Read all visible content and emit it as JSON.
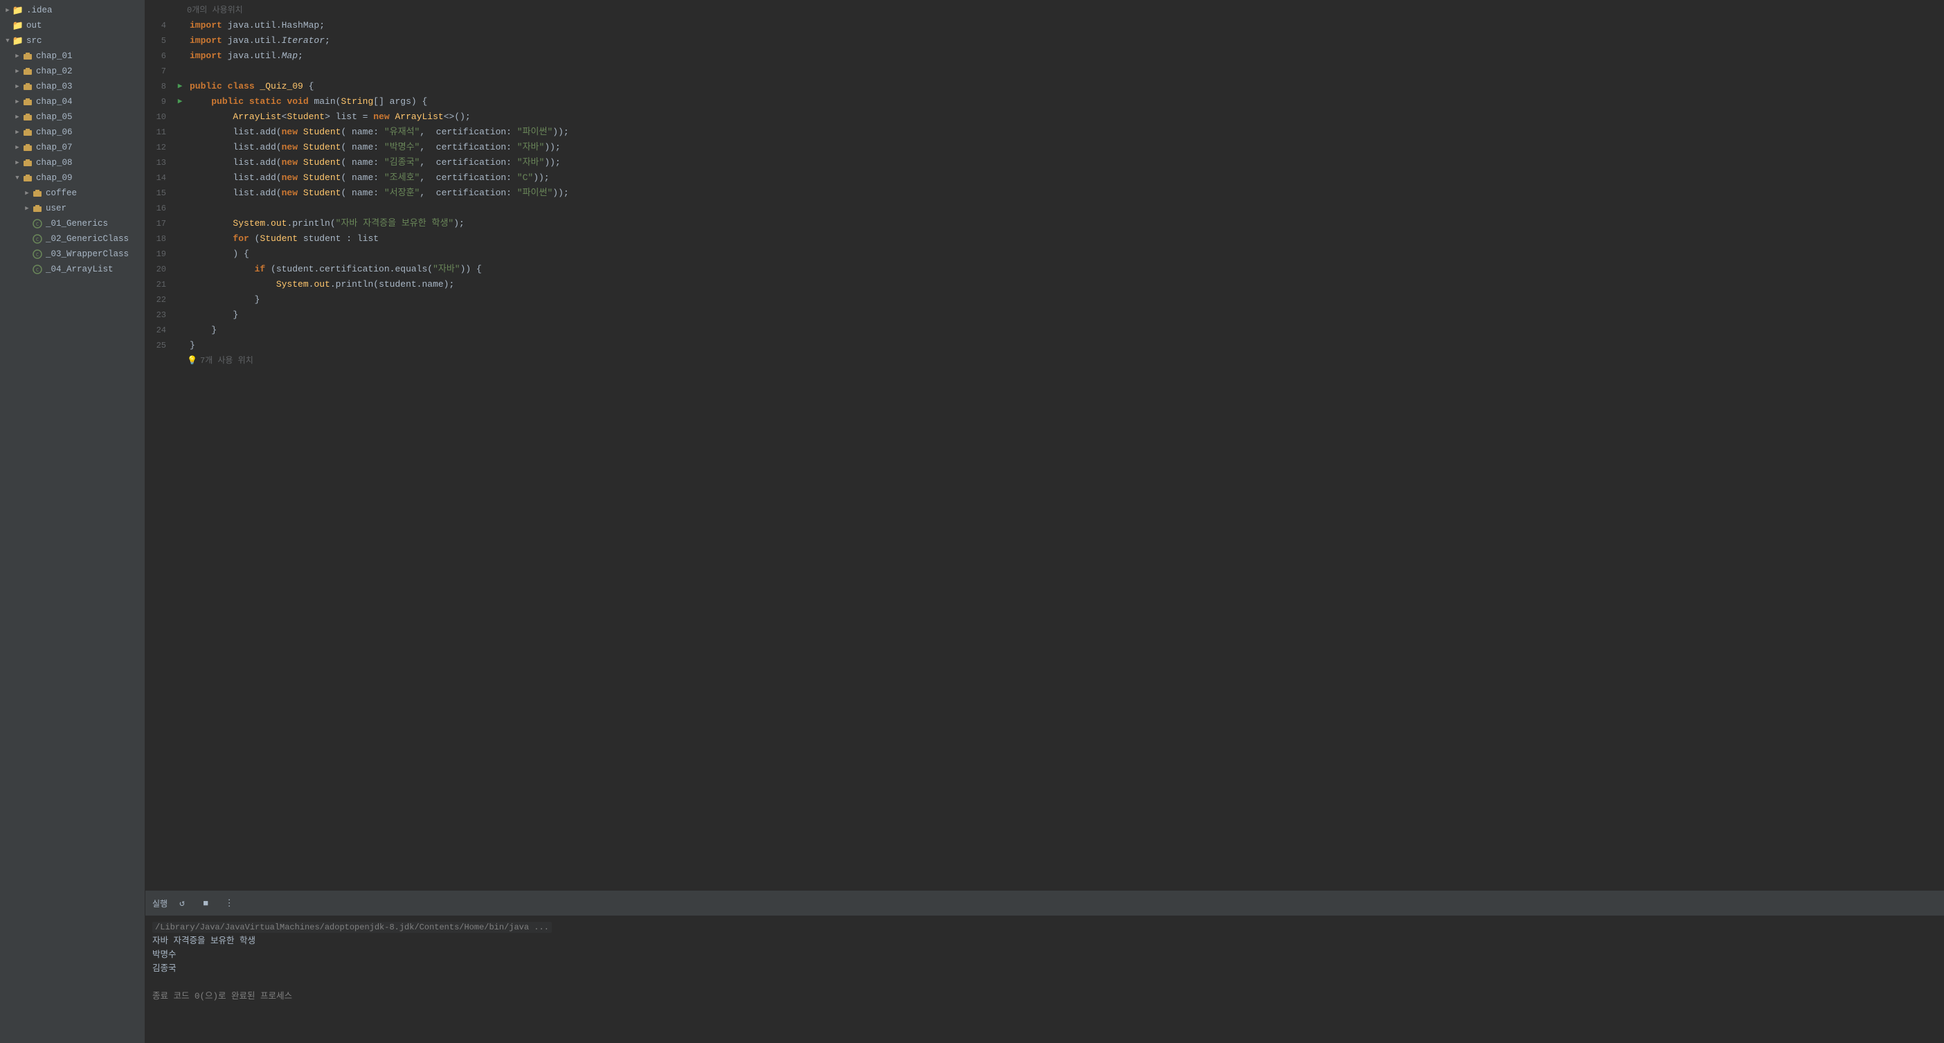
{
  "sidebar": {
    "items": [
      {
        "id": "idea",
        "label": ".idea",
        "indent": "indent-0",
        "type": "folder",
        "arrow": "▶",
        "expanded": false
      },
      {
        "id": "out",
        "label": "out",
        "indent": "indent-0",
        "type": "folder",
        "arrow": "",
        "expanded": false
      },
      {
        "id": "src",
        "label": "src",
        "indent": "indent-0",
        "type": "folder",
        "arrow": "▼",
        "expanded": true
      },
      {
        "id": "chap_01",
        "label": "chap_01",
        "indent": "indent-1",
        "type": "package",
        "arrow": "▶",
        "expanded": false
      },
      {
        "id": "chap_02",
        "label": "chap_02",
        "indent": "indent-1",
        "type": "package",
        "arrow": "▶",
        "expanded": false
      },
      {
        "id": "chap_03",
        "label": "chap_03",
        "indent": "indent-1",
        "type": "package",
        "arrow": "▶",
        "expanded": false
      },
      {
        "id": "chap_04",
        "label": "chap_04",
        "indent": "indent-1",
        "type": "package",
        "arrow": "▶",
        "expanded": false
      },
      {
        "id": "chap_05",
        "label": "chap_05",
        "indent": "indent-1",
        "type": "package",
        "arrow": "▶",
        "expanded": false
      },
      {
        "id": "chap_06",
        "label": "chap_06",
        "indent": "indent-1",
        "type": "package",
        "arrow": "▶",
        "expanded": false
      },
      {
        "id": "chap_07",
        "label": "chap_07",
        "indent": "indent-1",
        "type": "package",
        "arrow": "▶",
        "expanded": false
      },
      {
        "id": "chap_08",
        "label": "chap_08",
        "indent": "indent-1",
        "type": "package",
        "arrow": "▶",
        "expanded": false
      },
      {
        "id": "chap_09",
        "label": "chap_09",
        "indent": "indent-1",
        "type": "package",
        "arrow": "▼",
        "expanded": true
      },
      {
        "id": "coffee",
        "label": "coffee",
        "indent": "indent-2",
        "type": "package",
        "arrow": "▶",
        "expanded": false
      },
      {
        "id": "user",
        "label": "user",
        "indent": "indent-2",
        "type": "package",
        "arrow": "▶",
        "expanded": false
      },
      {
        "id": "_01_Generics",
        "label": "_01_Generics",
        "indent": "indent-2",
        "type": "class",
        "arrow": "",
        "expanded": false
      },
      {
        "id": "_02_GenericClass",
        "label": "_02_GenericClass",
        "indent": "indent-2",
        "type": "class",
        "arrow": "",
        "expanded": false
      },
      {
        "id": "_03_WrapperClass",
        "label": "_03_WrapperClass",
        "indent": "indent-2",
        "type": "class",
        "arrow": "",
        "expanded": false
      },
      {
        "id": "_04_ArrayList",
        "label": "_04_ArrayList",
        "indent": "indent-2",
        "type": "class",
        "arrow": "",
        "expanded": false
      }
    ]
  },
  "code": {
    "hint_top": "0개의 사용위치",
    "hint_bottom": "7개 사용 위치",
    "lines": [
      {
        "num": 4,
        "run": false,
        "content": "import java.util.HashMap;",
        "tokens": [
          {
            "t": "kw",
            "v": "import "
          },
          {
            "t": "plain",
            "v": "java.util.HashMap;"
          }
        ]
      },
      {
        "num": 5,
        "run": false,
        "content": "import java.util.Iterator;",
        "tokens": [
          {
            "t": "kw",
            "v": "import "
          },
          {
            "t": "plain",
            "v": "java.util."
          },
          {
            "t": "italic plain",
            "v": "Iterator"
          },
          {
            "t": "plain",
            "v": ";"
          }
        ]
      },
      {
        "num": 6,
        "run": false,
        "content": "import java.util.Map;",
        "tokens": [
          {
            "t": "kw",
            "v": "import "
          },
          {
            "t": "plain",
            "v": "java.util."
          },
          {
            "t": "italic plain",
            "v": "Map"
          },
          {
            "t": "plain",
            "v": ";"
          }
        ]
      },
      {
        "num": 7,
        "run": false,
        "content": "",
        "tokens": []
      },
      {
        "num": 8,
        "run": true,
        "content": "public class _Quiz_09 {",
        "tokens": [
          {
            "t": "kw",
            "v": "public "
          },
          {
            "t": "kw",
            "v": "class "
          },
          {
            "t": "cls",
            "v": "_Quiz_09"
          },
          {
            "t": "plain",
            "v": " {"
          }
        ]
      },
      {
        "num": 9,
        "run": true,
        "content": "    public static void main(String[] args) {",
        "tokens": [
          {
            "t": "plain",
            "v": "    "
          },
          {
            "t": "kw",
            "v": "public "
          },
          {
            "t": "kw",
            "v": "static "
          },
          {
            "t": "kw",
            "v": "void "
          },
          {
            "t": "plain",
            "v": "main("
          },
          {
            "t": "cls",
            "v": "String"
          },
          {
            "t": "plain",
            "v": "[] args) {"
          }
        ]
      },
      {
        "num": 10,
        "run": false,
        "content": "        ArrayList<Student> list = new ArrayList<>();",
        "tokens": [
          {
            "t": "plain",
            "v": "        "
          },
          {
            "t": "cls",
            "v": "ArrayList"
          },
          {
            "t": "plain",
            "v": "<"
          },
          {
            "t": "cls",
            "v": "Student"
          },
          {
            "t": "plain",
            "v": "> list = "
          },
          {
            "t": "kw",
            "v": "new "
          },
          {
            "t": "cls",
            "v": "ArrayList"
          },
          {
            "t": "plain",
            "v": "<>();"
          }
        ]
      },
      {
        "num": 11,
        "run": false,
        "content": "        list.add(new Student( name: \"유재석\",  certification: \"파이썬\"));",
        "tokens": [
          {
            "t": "plain",
            "v": "        list.add("
          },
          {
            "t": "kw",
            "v": "new "
          },
          {
            "t": "cls",
            "v": "Student"
          },
          {
            "t": "plain",
            "v": "( name: "
          },
          {
            "t": "str",
            "v": "\"유재석\""
          },
          {
            "t": "plain",
            "v": ",  certification: "
          },
          {
            "t": "str",
            "v": "\"파이썬\""
          },
          {
            "t": "plain",
            "v": "));"
          }
        ]
      },
      {
        "num": 12,
        "run": false,
        "content": "        list.add(new Student( name: \"박명수\",  certification: \"자바\"));",
        "tokens": [
          {
            "t": "plain",
            "v": "        list.add("
          },
          {
            "t": "kw",
            "v": "new "
          },
          {
            "t": "cls",
            "v": "Student"
          },
          {
            "t": "plain",
            "v": "( name: "
          },
          {
            "t": "str",
            "v": "\"박명수\""
          },
          {
            "t": "plain",
            "v": ",  certification: "
          },
          {
            "t": "str",
            "v": "\"자바\""
          },
          {
            "t": "plain",
            "v": "));"
          }
        ]
      },
      {
        "num": 13,
        "run": false,
        "content": "        list.add(new Student( name: \"김종국\",  certification: \"자바\"));",
        "tokens": [
          {
            "t": "plain",
            "v": "        list.add("
          },
          {
            "t": "kw",
            "v": "new "
          },
          {
            "t": "cls",
            "v": "Student"
          },
          {
            "t": "plain",
            "v": "( name: "
          },
          {
            "t": "str",
            "v": "\"김종국\""
          },
          {
            "t": "plain",
            "v": ",  certification: "
          },
          {
            "t": "str",
            "v": "\"자바\""
          },
          {
            "t": "plain",
            "v": "));"
          }
        ]
      },
      {
        "num": 14,
        "run": false,
        "content": "        list.add(new Student( name: \"조세호\",  certification: \"C\"));",
        "tokens": [
          {
            "t": "plain",
            "v": "        list.add("
          },
          {
            "t": "kw",
            "v": "new "
          },
          {
            "t": "cls",
            "v": "Student"
          },
          {
            "t": "plain",
            "v": "( name: "
          },
          {
            "t": "str",
            "v": "\"조세호\""
          },
          {
            "t": "plain",
            "v": ",  certification: "
          },
          {
            "t": "str",
            "v": "\"C\""
          },
          {
            "t": "plain",
            "v": "));"
          }
        ]
      },
      {
        "num": 15,
        "run": false,
        "content": "        list.add(new Student( name: \"서장훈\",  certification: \"파이썬\"));",
        "tokens": [
          {
            "t": "plain",
            "v": "        list.add("
          },
          {
            "t": "kw",
            "v": "new "
          },
          {
            "t": "cls",
            "v": "Student"
          },
          {
            "t": "plain",
            "v": "( name: "
          },
          {
            "t": "str",
            "v": "\"서장훈\""
          },
          {
            "t": "plain",
            "v": ",  certification: "
          },
          {
            "t": "str",
            "v": "\"파이썬\""
          },
          {
            "t": "plain",
            "v": "));"
          }
        ]
      },
      {
        "num": 16,
        "run": false,
        "content": "",
        "tokens": []
      },
      {
        "num": 17,
        "run": false,
        "content": "        System.out.println(\"자바 자격증을 보유한 학생\");",
        "tokens": [
          {
            "t": "plain",
            "v": "        "
          },
          {
            "t": "cls",
            "v": "System"
          },
          {
            "t": "plain",
            "v": "."
          },
          {
            "t": "fn",
            "v": "out"
          },
          {
            "t": "plain",
            "v": ".println("
          },
          {
            "t": "str",
            "v": "\"자바 자격증을 보유한 학생\""
          },
          {
            "t": "plain",
            "v": ");"
          }
        ]
      },
      {
        "num": 18,
        "run": false,
        "content": "        for (Student student : list",
        "tokens": [
          {
            "t": "plain",
            "v": "        "
          },
          {
            "t": "kw",
            "v": "for "
          },
          {
            "t": "plain",
            "v": "("
          },
          {
            "t": "cls",
            "v": "Student"
          },
          {
            "t": "plain",
            "v": " student : list"
          }
        ]
      },
      {
        "num": 19,
        "run": false,
        "content": "        ) {",
        "tokens": [
          {
            "t": "plain",
            "v": "        ) {"
          }
        ]
      },
      {
        "num": 20,
        "run": false,
        "content": "            if (student.certification.equals(\"자바\")) {",
        "tokens": [
          {
            "t": "plain",
            "v": "            "
          },
          {
            "t": "kw",
            "v": "if "
          },
          {
            "t": "plain",
            "v": "(student.certification.equals("
          },
          {
            "t": "str",
            "v": "\"자바\""
          },
          {
            "t": "plain",
            "v": ")) {"
          }
        ]
      },
      {
        "num": 21,
        "run": false,
        "content": "                System.out.println(student.name);",
        "tokens": [
          {
            "t": "plain",
            "v": "                "
          },
          {
            "t": "cls",
            "v": "System"
          },
          {
            "t": "plain",
            "v": "."
          },
          {
            "t": "fn",
            "v": "out"
          },
          {
            "t": "plain",
            "v": ".println(student.name);"
          }
        ]
      },
      {
        "num": 22,
        "run": false,
        "content": "            }",
        "tokens": [
          {
            "t": "plain",
            "v": "            }"
          }
        ]
      },
      {
        "num": 23,
        "run": false,
        "content": "        }",
        "tokens": [
          {
            "t": "plain",
            "v": "        }"
          }
        ]
      },
      {
        "num": 24,
        "run": false,
        "content": "    }",
        "tokens": [
          {
            "t": "plain",
            "v": "    }"
          }
        ]
      },
      {
        "num": 25,
        "run": false,
        "content": "}",
        "tokens": [
          {
            "t": "plain",
            "v": "}"
          }
        ]
      }
    ]
  },
  "console": {
    "toolbar": {
      "run_label": "실행",
      "more_icon": "⋮"
    },
    "path": "/Library/Java/JavaVirtualMachines/adoptopenjdk-8.jdk/Contents/Home/bin/java ...",
    "output_lines": [
      "자바 자격증을 보유한 학생",
      "박명수",
      "김종국",
      "",
      "종료 코드 0(으)로 완료된 프로세스"
    ]
  }
}
